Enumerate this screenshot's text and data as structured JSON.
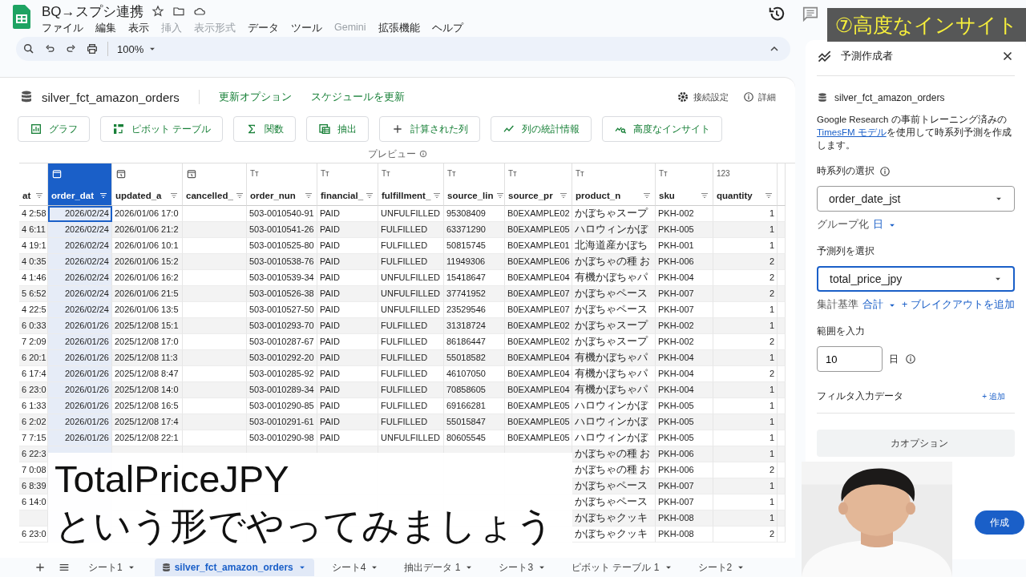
{
  "app": {
    "title": "BQ→スプシ連携",
    "menu": [
      {
        "label": "ファイル",
        "disabled": false
      },
      {
        "label": "編集",
        "disabled": false
      },
      {
        "label": "表示",
        "disabled": false
      },
      {
        "label": "挿入",
        "disabled": true
      },
      {
        "label": "表示形式",
        "disabled": true
      },
      {
        "label": "データ",
        "disabled": false
      },
      {
        "label": "ツール",
        "disabled": false
      },
      {
        "label": "Gemini",
        "disabled": true
      },
      {
        "label": "拡張機能",
        "disabled": false
      },
      {
        "label": "ヘルプ",
        "disabled": false
      }
    ],
    "zoom": "100%"
  },
  "connected_sheet": {
    "name": "silver_fct_amazon_orders",
    "links": [
      "更新オプション",
      "スケジュールを更新"
    ],
    "settings": "接続設定",
    "details": "詳細",
    "preview": "プレビュー",
    "actions": [
      "グラフ",
      "ピボット テーブル",
      "関数",
      "抽出",
      "計算された列",
      "列の統計情報",
      "高度なインサイト"
    ]
  },
  "table": {
    "columns": [
      {
        "name": "at",
        "kind": "none",
        "selected": false
      },
      {
        "name": "order_dat",
        "kind": "date",
        "selected": true
      },
      {
        "name": "updated_a",
        "kind": "datetime",
        "selected": false
      },
      {
        "name": "cancelled_",
        "kind": "datetime",
        "selected": false
      },
      {
        "name": "order_nun",
        "kind": "text",
        "glyph": "Tт",
        "selected": false
      },
      {
        "name": "financial_",
        "kind": "text",
        "glyph": "Tт",
        "selected": false
      },
      {
        "name": "fulfillment_",
        "kind": "text",
        "glyph": "Tт",
        "selected": false
      },
      {
        "name": "source_lin",
        "kind": "text",
        "glyph": "Tт",
        "selected": false
      },
      {
        "name": "source_pr",
        "kind": "text",
        "glyph": "Tт",
        "selected": false
      },
      {
        "name": "product_n",
        "kind": "text",
        "glyph": "Tт",
        "selected": false
      },
      {
        "name": "sku",
        "kind": "text",
        "glyph": "Tт",
        "selected": false
      },
      {
        "name": "quantity",
        "kind": "number",
        "glyph": "123",
        "selected": false
      }
    ],
    "rows": [
      [
        "4 2:58",
        "2026/02/24",
        "2026/01/06 17:0",
        null,
        "503-0010540-91",
        "PAID",
        "UNFULFILLED",
        "95308409",
        "B0EXAMPLE02",
        "かぼちゃスープ",
        "PKH-002",
        "1"
      ],
      [
        "4 6:11",
        "2026/02/24",
        "2026/01/06 21:2",
        null,
        "503-0010541-26",
        "PAID",
        "FULFILLED",
        "63371290",
        "B0EXAMPLE05",
        "ハロウィンかぼ",
        "PKH-005",
        "1"
      ],
      [
        "4 19:1",
        "2026/02/24",
        "2026/01/06 10:1",
        null,
        "503-0010525-80",
        "PAID",
        "FULFILLED",
        "50815745",
        "B0EXAMPLE01",
        "北海道産かぼち",
        "PKH-001",
        "1"
      ],
      [
        "4 0:35",
        "2026/02/24",
        "2026/01/06 15:2",
        null,
        "503-0010538-76",
        "PAID",
        "FULFILLED",
        "11949306",
        "B0EXAMPLE06",
        "かぼちゃの種 お",
        "PKH-006",
        "2"
      ],
      [
        "4 1:46",
        "2026/02/24",
        "2026/01/06 16:2",
        null,
        "503-0010539-34",
        "PAID",
        "UNFULFILLED",
        "15418647",
        "B0EXAMPLE04",
        "有機かぼちゃパ",
        "PKH-004",
        "2"
      ],
      [
        "5 6:52",
        "2026/02/24",
        "2026/01/06 21:5",
        null,
        "503-0010526-38",
        "PAID",
        "UNFULFILLED",
        "37741952",
        "B0EXAMPLE07",
        "かぼちゃペース",
        "PKH-007",
        "2"
      ],
      [
        "4 22:5",
        "2026/02/24",
        "2026/01/06 13:5",
        null,
        "503-0010527-50",
        "PAID",
        "UNFULFILLED",
        "23529546",
        "B0EXAMPLE07",
        "かぼちゃペース",
        "PKH-007",
        "1"
      ],
      [
        "6 0:33",
        "2026/01/26",
        "2025/12/08 15:1",
        null,
        "503-0010293-70",
        "PAID",
        "FULFILLED",
        "31318724",
        "B0EXAMPLE02",
        "かぼちゃスープ",
        "PKH-002",
        "1"
      ],
      [
        "7 2:09",
        "2026/01/26",
        "2025/12/08 17:0",
        null,
        "503-0010287-67",
        "PAID",
        "FULFILLED",
        "86186447",
        "B0EXAMPLE02",
        "かぼちゃスープ",
        "PKH-002",
        "2"
      ],
      [
        "6 20:1",
        "2026/01/26",
        "2025/12/08 11:3",
        null,
        "503-0010292-20",
        "PAID",
        "FULFILLED",
        "55018582",
        "B0EXAMPLE04",
        "有機かぼちゃパ",
        "PKH-004",
        "1"
      ],
      [
        "6 17:4",
        "2026/01/26",
        "2025/12/08 8:47",
        null,
        "503-0010285-92",
        "PAID",
        "FULFILLED",
        "46107050",
        "B0EXAMPLE04",
        "有機かぼちゃパ",
        "PKH-004",
        "2"
      ],
      [
        "6 23:0",
        "2026/01/26",
        "2025/12/08 14:0",
        null,
        "503-0010289-34",
        "PAID",
        "FULFILLED",
        "70858605",
        "B0EXAMPLE04",
        "有機かぼちゃパ",
        "PKH-004",
        "1"
      ],
      [
        "6 1:33",
        "2026/01/26",
        "2025/12/08 16:5",
        null,
        "503-0010290-85",
        "PAID",
        "FULFILLED",
        "69166281",
        "B0EXAMPLE05",
        "ハロウィンかぼ",
        "PKH-005",
        "1"
      ],
      [
        "6 2:02",
        "2026/01/26",
        "2025/12/08 17:4",
        null,
        "503-0010291-61",
        "PAID",
        "FULFILLED",
        "55015847",
        "B0EXAMPLE05",
        "ハロウィンかぼ",
        "PKH-005",
        "1"
      ],
      [
        "7 7:15",
        "2026/01/26",
        "2025/12/08 22:1",
        null,
        "503-0010290-98",
        "PAID",
        "UNFULFILLED",
        "80605545",
        "B0EXAMPLE05",
        "ハロウィンかぼ",
        "PKH-005",
        "1"
      ],
      [
        "6 22:3",
        null,
        null,
        null,
        null,
        null,
        null,
        null,
        null,
        "かぼちゃの種 お",
        "PKH-006",
        "1"
      ],
      [
        "7 0:08",
        null,
        null,
        null,
        null,
        null,
        null,
        null,
        null,
        "かぼちゃの種 お",
        "PKH-006",
        "2"
      ],
      [
        "6 8:39",
        null,
        null,
        null,
        null,
        null,
        null,
        null,
        null,
        "かぼちゃペース",
        "PKH-007",
        "1"
      ],
      [
        "6 14:0",
        null,
        null,
        null,
        null,
        null,
        null,
        null,
        null,
        "かぼちゃペース",
        "PKH-007",
        "1"
      ],
      [
        null,
        null,
        null,
        null,
        null,
        null,
        null,
        null,
        null,
        "かぼちゃクッキ",
        "PKH-008",
        "1"
      ],
      [
        "6 23:0",
        null,
        null,
        null,
        null,
        null,
        null,
        null,
        null,
        "かぼちゃクッキ",
        "PKH-008",
        "2"
      ]
    ]
  },
  "caption": [
    "TotalPriceJPY",
    "という形でやってみましょう"
  ],
  "badge": "⑦高度なインサイト",
  "panel": {
    "title": "予測作成者",
    "dataset": "silver_fct_amazon_orders",
    "desc_before": "Google Research の事前トレーニング済みの",
    "desc_link": "TimesFM モデル",
    "desc_after": "を使用して時系列予測を作成します。",
    "time_label": "時系列の選択",
    "time_value": "order_date_jst",
    "time_focused": false,
    "group_label": "グループ化",
    "group_value": "日",
    "target_label": "予測列を選択",
    "target_value": "total_price_jpy",
    "target_focused": true,
    "agg_label": "集計基準",
    "agg_value": "合計",
    "breakout": "+ ブレイクアウトを追加",
    "range_label": "範囲を入力",
    "range_value": "10",
    "range_unit": "日",
    "filter_label": "フィルタ入力データ",
    "filter_add": "+ 追加",
    "options": "カオプション",
    "create": "作成"
  },
  "sheet_tabs": [
    {
      "label": "シート1",
      "selected": false,
      "kind": "sheet"
    },
    {
      "label": "silver_fct_amazon_orders",
      "selected": true,
      "kind": "connected"
    },
    {
      "label": "シート4",
      "selected": false,
      "kind": "sheet"
    },
    {
      "label": "抽出データ 1",
      "selected": false,
      "kind": "sheet"
    },
    {
      "label": "シート3",
      "selected": false,
      "kind": "sheet"
    },
    {
      "label": "ピボット テーブル 1",
      "selected": false,
      "kind": "sheet"
    },
    {
      "label": "シート2",
      "selected": false,
      "kind": "sheet"
    }
  ]
}
